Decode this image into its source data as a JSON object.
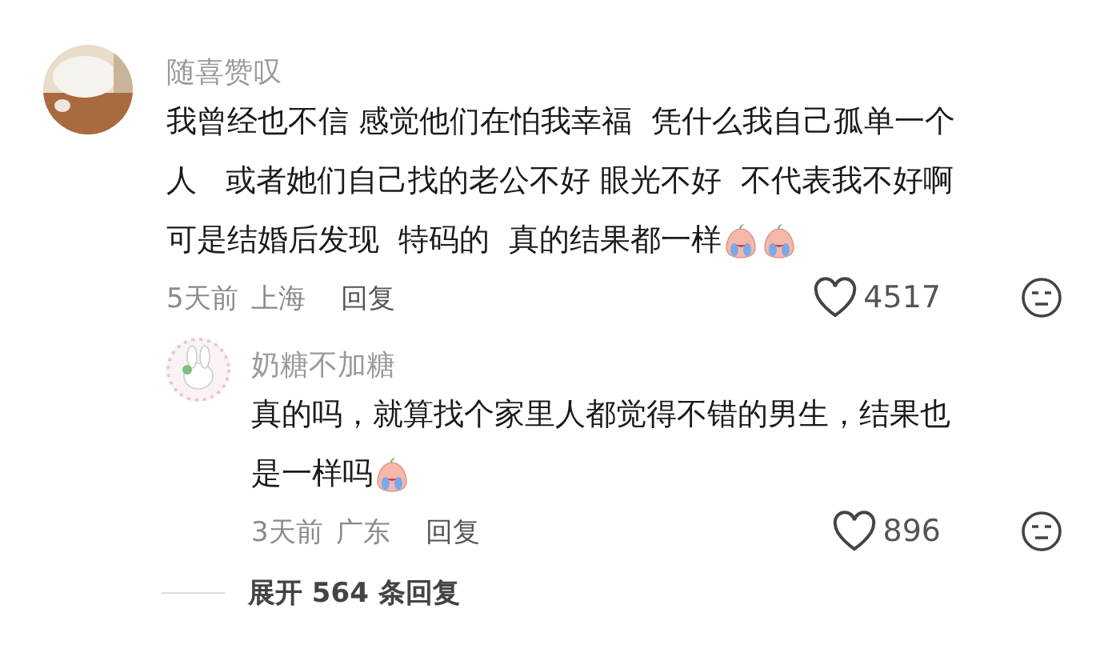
{
  "comments": [
    {
      "username": "随喜赞叹",
      "lines": [
        "我曾经也不信 感觉他们在怕我幸福  凭什么我自己孤单一个",
        "人   或者她们自己找的老公不好 眼光不好  不代表我不好啊",
        "可是结婚后发现  特码的  真的结果都一样"
      ],
      "emojis": [
        {
          "kind": "crying"
        },
        {
          "kind": "crying"
        }
      ],
      "time": "5天前",
      "location": "上海",
      "reply": "回复",
      "likes": "4517",
      "children": [
        {
          "username": "奶糖不加糖",
          "lines": [
            "真的吗，就算找个家里人都觉得不错的男生，结果也",
            "是一样吗"
          ],
          "emojis": [
            {
              "kind": "crying"
            }
          ],
          "time": "3天前",
          "location": "广东",
          "reply": "回复",
          "likes": "896"
        }
      ],
      "expand": "展开 564 条回复"
    }
  ]
}
